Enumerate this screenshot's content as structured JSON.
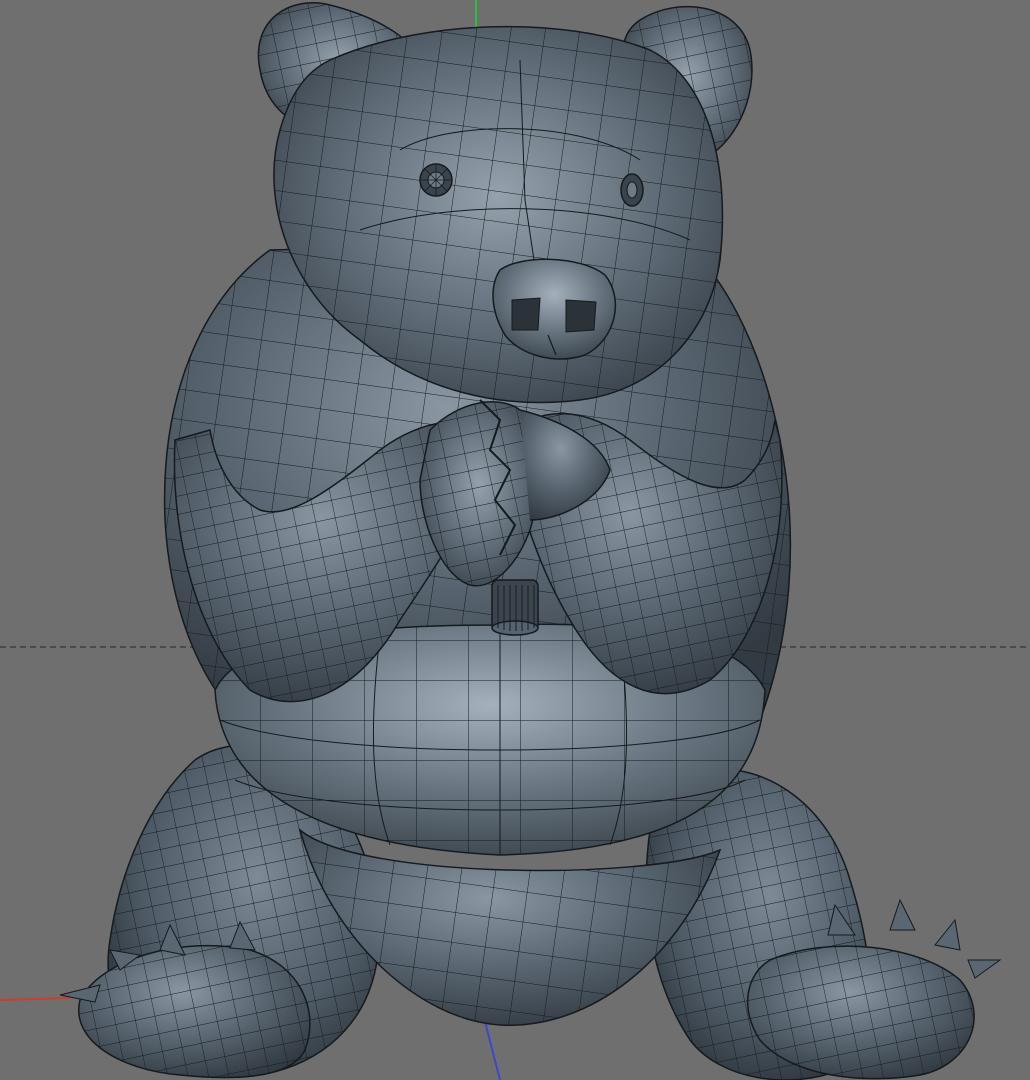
{
  "viewport": {
    "background": "#6f6f6f",
    "horizon_line_color": "#4a4a4a",
    "axes": {
      "x_color": "#d23a2a",
      "y_color": "#27c23a",
      "z_color": "#3a48d0"
    }
  },
  "model": {
    "name": "panda",
    "shading": "gouraud-with-wireframe",
    "base_color": "#4f5b66",
    "highlight_color": "#9aa7b2",
    "shadow_color": "#2e353c",
    "wire_color": "#151a1e"
  }
}
